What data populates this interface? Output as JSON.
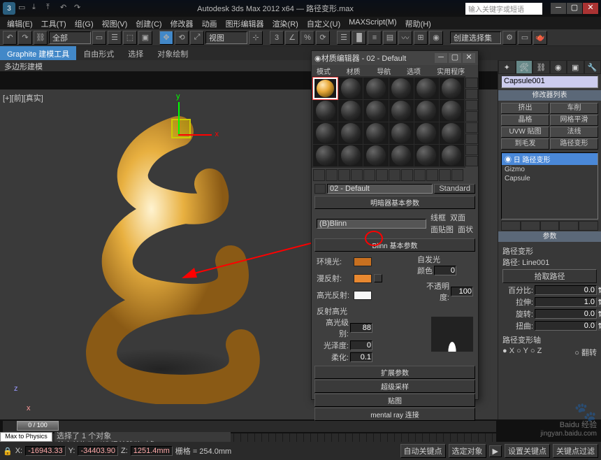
{
  "title": "Autodesk 3ds Max 2012 x64 — 路径变形.max",
  "search_placeholder": "输入关键字或短语",
  "menus": [
    "编辑(E)",
    "工具(T)",
    "组(G)",
    "视图(V)",
    "创建(C)",
    "修改器",
    "动画",
    "图形编辑器",
    "渲染(R)",
    "自定义(U)",
    "MAXScript(M)",
    "帮助(H)"
  ],
  "toolbar_dropdown": "全部",
  "render_dropdown": "创建选择集",
  "ribbon": {
    "tabs": [
      "Graphite 建模工具",
      "自由形式",
      "选择",
      "对象绘制"
    ],
    "sub": "多边形建模"
  },
  "viewport_label": "[+][前][真实]",
  "cmd": {
    "name": "Capsule001",
    "modifier_hdr": "修改器列表",
    "btns": [
      "挤出",
      "车削",
      "晶格",
      "网格平滑",
      "UVW 贴图",
      "法线",
      "到毛发",
      "路径变形"
    ],
    "mods": [
      "◉ 日 路径变形",
      "  Gizmo",
      "  Capsule"
    ],
    "params_hdr": "参数",
    "path_label": "路径变形",
    "path_info": "路径: Line001",
    "pick_btn": "拾取路径",
    "pct_label": "百分比:",
    "pct": "0.0",
    "stretch_label": "拉伸:",
    "stretch": "1.0",
    "rot_label": "旋转:",
    "rot": "0.0",
    "twist_label": "扭曲:",
    "twist": "0.0",
    "axis_hdr": "路径变形轴",
    "axes": [
      "X",
      "Y",
      "Z"
    ],
    "flip": "翻转"
  },
  "mat": {
    "title": "材质编辑器 - 02 - Default",
    "menus": [
      "模式(D)",
      "材质(M)",
      "导航(N)",
      "选项(O)",
      "实用程序(U)"
    ],
    "name": "02 - Default",
    "type": "Standard",
    "shader_hdr": "明暗器基本参数",
    "shader": "(B)Blinn",
    "chk1": [
      "线框",
      "双面"
    ],
    "chk2": [
      "面贴图",
      "面状"
    ],
    "blinn_hdr": "Blinn 基本参数",
    "ambient": "环境光:",
    "diffuse": "漫反射:",
    "specular": "高光反射:",
    "selfillum_hdr": "自发光",
    "selfillum_color": "颜色",
    "selfillum_val": "0",
    "opacity": "不透明度:",
    "opacity_val": "100",
    "spec_hdr": "反射高光",
    "spec_level": "高光级别:",
    "spec_level_val": "88",
    "gloss": "光泽度:",
    "gloss_val": "0",
    "soften": "柔化:",
    "soften_val": "0.1",
    "rolls": [
      "扩展参数",
      "超级采样",
      "贴图",
      "mental ray 连接"
    ]
  },
  "time": "0 / 100",
  "maxscript": "Max to Physics",
  "prompt1": "选择了 1 个对象",
  "prompt2": "单击并拖动以选择并移动对象",
  "coords": {
    "x": "-16943.33",
    "y": "-34403.90",
    "z": "1251.4mm"
  },
  "grid": "栅格 = 254.0mm",
  "autokey": "自动关键点",
  "setkey": "设置关键点",
  "selset": "选定对象",
  "keyfilt": "关键点过滤",
  "watermark": "Baidu 经验",
  "watermark_url": "jingyan.baidu.com"
}
